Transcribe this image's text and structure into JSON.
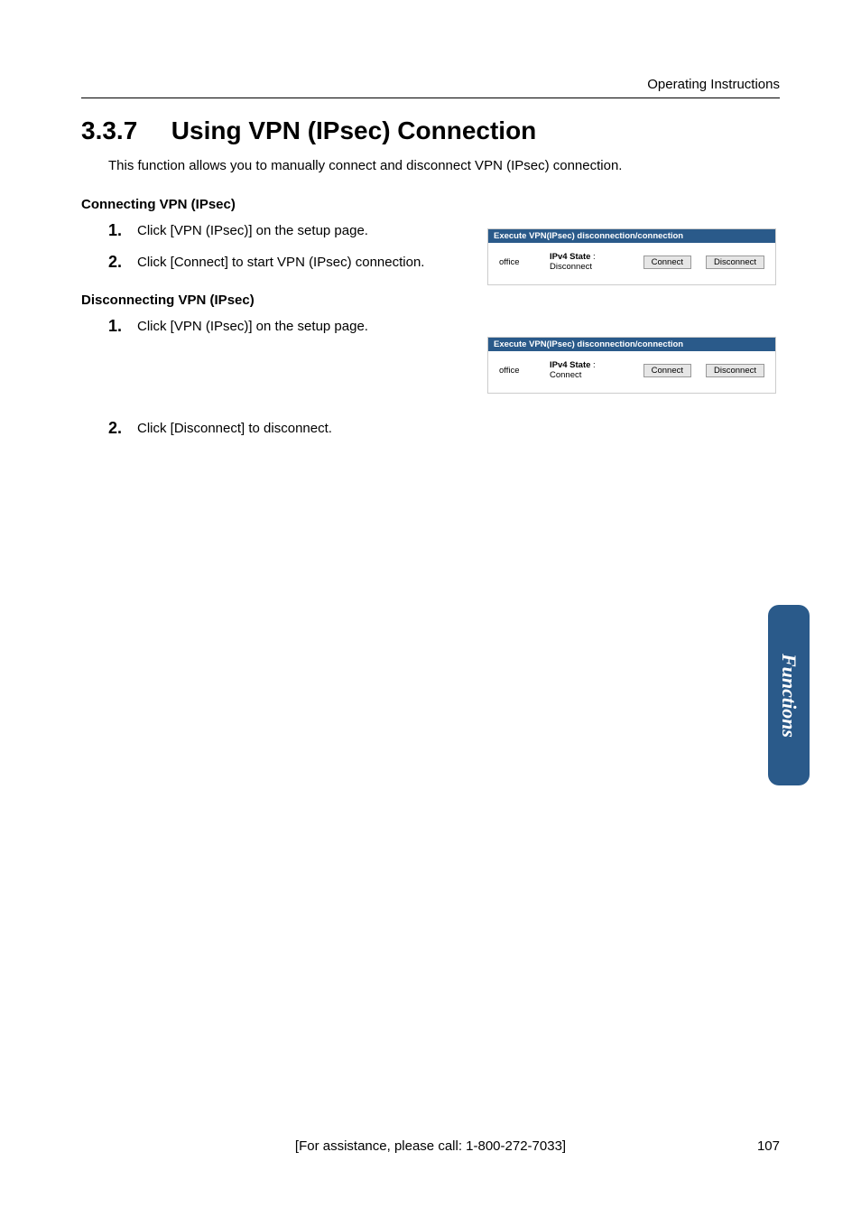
{
  "header": {
    "right": "Operating Instructions"
  },
  "section": {
    "number": "3.3.7",
    "title": "Using VPN (IPsec) Connection",
    "intro": "This function allows you to manually connect and disconnect VPN (IPsec) connection."
  },
  "connecting": {
    "heading": "Connecting VPN (IPsec)",
    "steps": [
      "Click [VPN (IPsec)] on the setup page.",
      "Click [Connect] to start VPN (IPsec) connection."
    ]
  },
  "disconnecting": {
    "heading": "Disconnecting VPN (IPsec)",
    "steps": [
      "Click [VPN (IPsec)] on the setup page.",
      "Click [Disconnect] to disconnect."
    ]
  },
  "ui_panel1": {
    "title": "Execute VPN(IPsec) disconnection/connection",
    "office": "office",
    "state_label": "IPv4 State",
    "state_value": "Disconnect",
    "connect_btn": "Connect",
    "disconnect_btn": "Disconnect"
  },
  "ui_panel2": {
    "title": "Execute VPN(IPsec) disconnection/connection",
    "office": "office",
    "state_label": "IPv4 State",
    "state_value": "Connect",
    "connect_btn": "Connect",
    "disconnect_btn": "Disconnect"
  },
  "side_tab": "Functions",
  "footer": {
    "assist": "[For assistance, please call: 1-800-272-7033]",
    "page": "107"
  }
}
